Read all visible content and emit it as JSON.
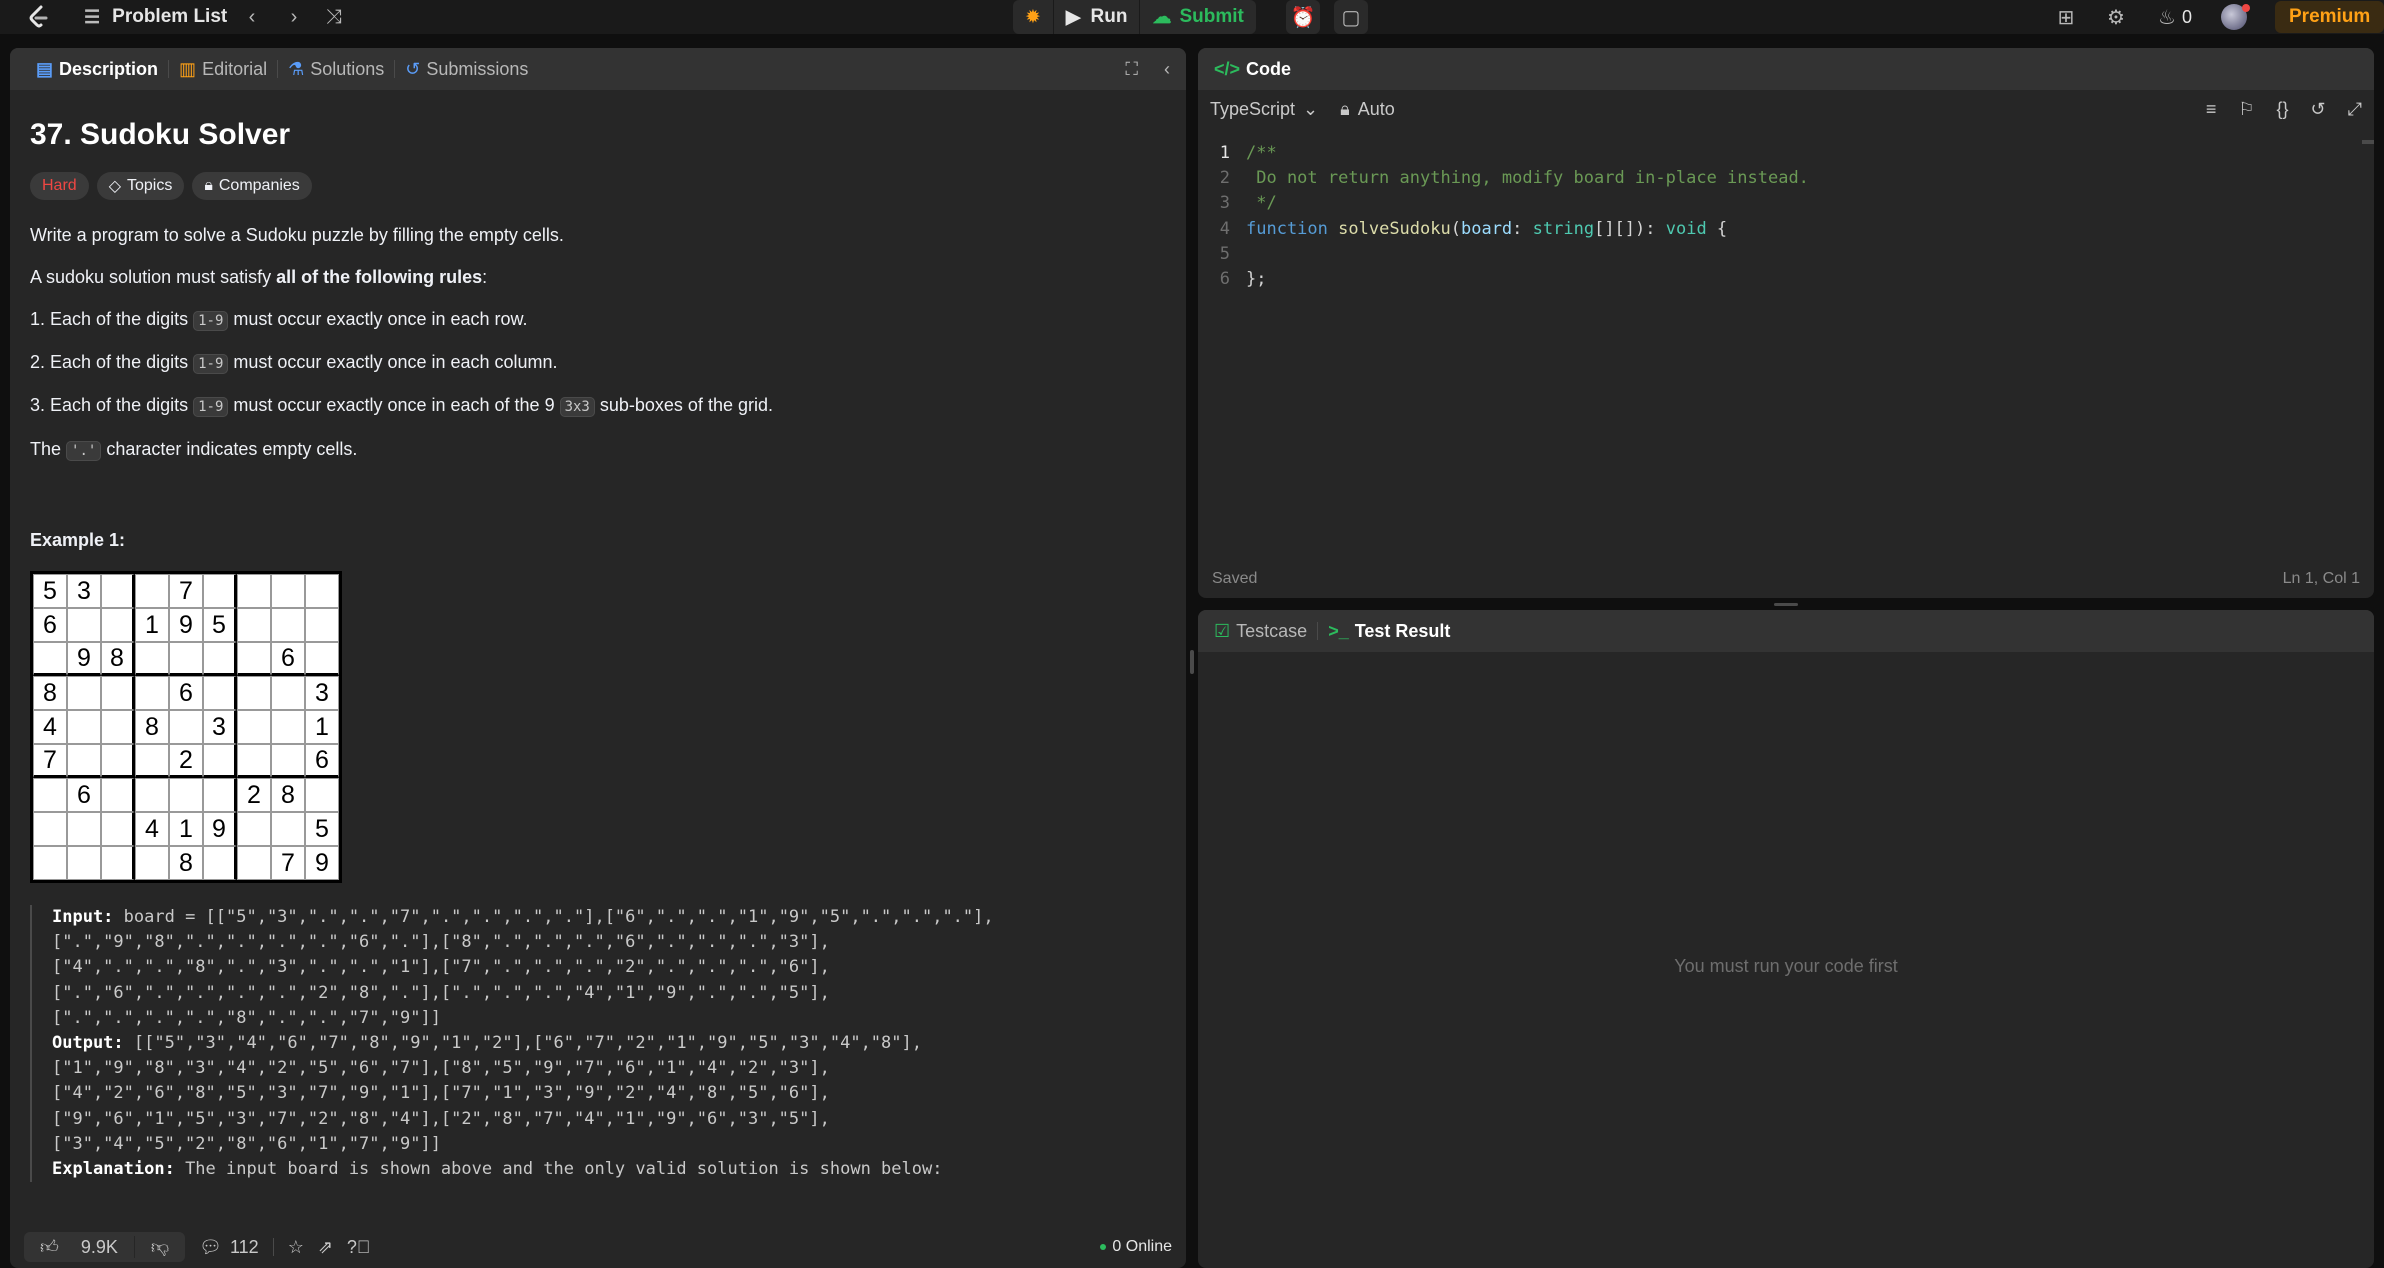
{
  "nav": {
    "problem_list": "Problem List",
    "run": "Run",
    "submit": "Submit",
    "streak": "0",
    "premium": "Premium"
  },
  "description_panel": {
    "tabs": [
      "Description",
      "Editorial",
      "Solutions",
      "Submissions"
    ],
    "title": "37. Sudoku Solver",
    "chips": {
      "difficulty": "Hard",
      "topics": "Topics",
      "companies": "Companies"
    },
    "intro": "Write a program to solve a Sudoku puzzle by filling the empty cells.",
    "rules_lead": "A sudoku solution must satisfy ",
    "rules_bold": "all of the following rules",
    "rules_tail": ":",
    "rules": [
      {
        "pre": "1. Each of the digits ",
        "code": "1-9",
        "post": " must occur exactly once in each row."
      },
      {
        "pre": "2. Each of the digits ",
        "code": "1-9",
        "post": " must occur exactly once in each column."
      },
      {
        "pre": "3. Each of the digits ",
        "code": "1-9",
        "mid": " must occur exactly once in each of the 9 ",
        "code2": "3x3",
        "post": " sub-boxes of the grid."
      }
    ],
    "empty_lead": "The ",
    "empty_code": "'.'",
    "empty_tail": " character indicates empty cells.",
    "example_title": "Example 1:",
    "board": [
      [
        "5",
        "3",
        "",
        "",
        "7",
        "",
        "",
        "",
        ""
      ],
      [
        "6",
        "",
        "",
        "1",
        "9",
        "5",
        "",
        "",
        ""
      ],
      [
        "",
        "9",
        "8",
        "",
        "",
        "",
        "",
        "6",
        ""
      ],
      [
        "8",
        "",
        "",
        "",
        "6",
        "",
        "",
        "",
        "3"
      ],
      [
        "4",
        "",
        "",
        "8",
        "",
        "3",
        "",
        "",
        "1"
      ],
      [
        "7",
        "",
        "",
        "",
        "2",
        "",
        "",
        "",
        "6"
      ],
      [
        "",
        "6",
        "",
        "",
        "",
        "",
        "2",
        "8",
        ""
      ],
      [
        "",
        "",
        "",
        "4",
        "1",
        "9",
        "",
        "",
        "5"
      ],
      [
        "",
        "",
        "",
        "",
        "8",
        "",
        "",
        "7",
        "9"
      ]
    ],
    "input_label": "Input:",
    "input_lines": [
      " board = [[\"5\",\"3\",\".\",\".\",\"7\",\".\",\".\",\".\",\".\"],[\"6\",\".\",\".\",\"1\",\"9\",\"5\",\".\",\".\",\".\"],",
      "[\".\",\"9\",\"8\",\".\",\".\",\".\",\".\",\"6\",\".\"],[\"8\",\".\",\".\",\".\",\"6\",\".\",\".\",\".\",\"3\"],",
      "[\"4\",\".\",\".\",\"8\",\".\",\"3\",\".\",\".\",\"1\"],[\"7\",\".\",\".\",\".\",\"2\",\".\",\".\",\".\",\"6\"],",
      "[\".\",\"6\",\".\",\".\",\".\",\".\",\"2\",\"8\",\".\"],[\".\",\".\",\".\",\"4\",\"1\",\"9\",\".\",\".\",\"5\"],",
      "[\".\",\".\",\".\",\".\",\"8\",\".\",\".\",\"7\",\"9\"]]"
    ],
    "output_label": "Output:",
    "output_lines": [
      " [[\"5\",\"3\",\"4\",\"6\",\"7\",\"8\",\"9\",\"1\",\"2\"],[\"6\",\"7\",\"2\",\"1\",\"9\",\"5\",\"3\",\"4\",\"8\"],",
      "[\"1\",\"9\",\"8\",\"3\",\"4\",\"2\",\"5\",\"6\",\"7\"],[\"8\",\"5\",\"9\",\"7\",\"6\",\"1\",\"4\",\"2\",\"3\"],",
      "[\"4\",\"2\",\"6\",\"8\",\"5\",\"3\",\"7\",\"9\",\"1\"],[\"7\",\"1\",\"3\",\"9\",\"2\",\"4\",\"8\",\"5\",\"6\"],",
      "[\"9\",\"6\",\"1\",\"5\",\"3\",\"7\",\"2\",\"8\",\"4\"],[\"2\",\"8\",\"7\",\"4\",\"1\",\"9\",\"6\",\"3\",\"5\"],",
      "[\"3\",\"4\",\"5\",\"2\",\"8\",\"6\",\"1\",\"7\",\"9\"]]"
    ],
    "explanation_label": "Explanation:",
    "explanation": " The input board is shown above and the only valid solution is shown below:",
    "footer": {
      "likes": "9.9K",
      "comments": "112",
      "online": "0 Online"
    }
  },
  "code_panel": {
    "tab": "Code",
    "language": "TypeScript",
    "auto": "Auto",
    "status": "Saved",
    "cursor": "Ln 1, Col 1",
    "line_numbers": [
      "1",
      "2",
      "3",
      "4",
      "5",
      "6"
    ]
  },
  "result_panel": {
    "tabs": [
      "Testcase",
      "Test Result"
    ],
    "empty": "You must run your code first"
  },
  "colors": {
    "accent": "#ffa116",
    "green": "#2cbb5d",
    "hard": "#ef4743"
  }
}
